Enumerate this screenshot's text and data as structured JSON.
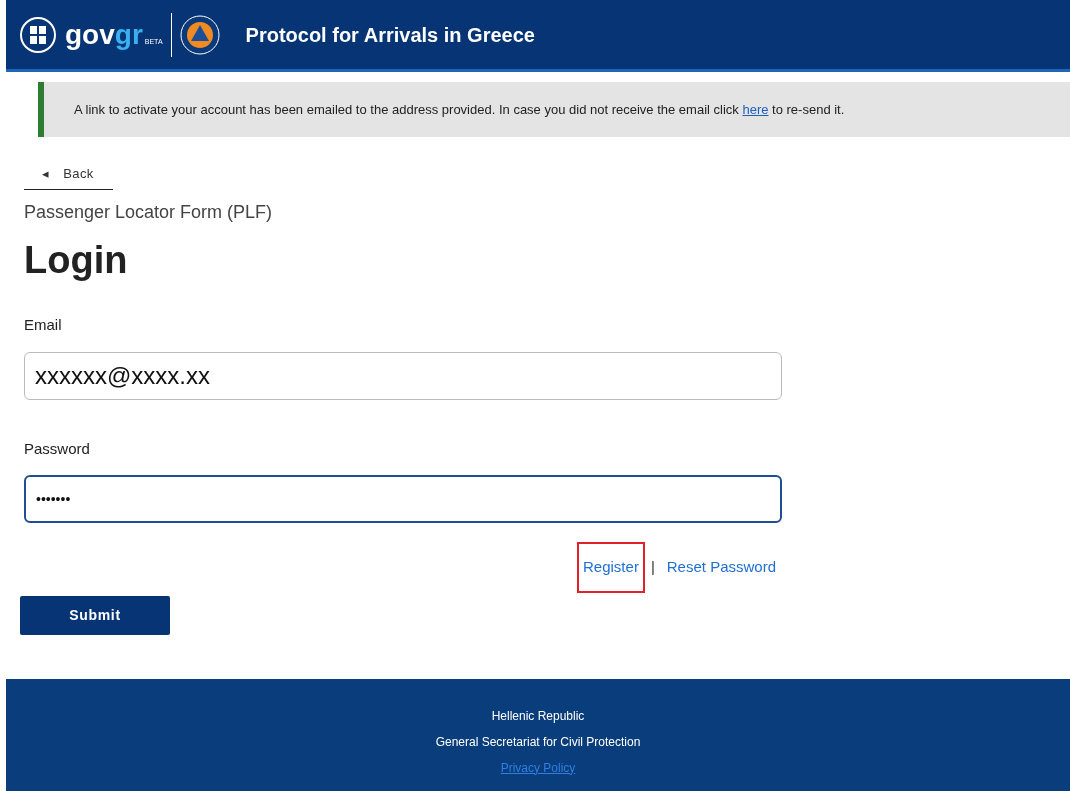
{
  "header": {
    "logo_gov": "gov",
    "logo_gr": "gr",
    "logo_beta": "BETA",
    "title": "Protocol for Arrivals in Greece"
  },
  "alert": {
    "text_before": "A link to activate your account has been emailed to the address provided. In case you did not receive the email click ",
    "link": "here",
    "text_after": " to re-send it."
  },
  "back": {
    "arrow": "◂",
    "label": "Back"
  },
  "subtitle": "Passenger Locator Form (PLF)",
  "heading": "Login",
  "fields": [
    {
      "label": "Email",
      "value": "xxxxxx@xxxx.xx",
      "kind": "email",
      "focused": false
    },
    {
      "label": "Password",
      "value": "•••••••",
      "kind": "password",
      "focused": true
    }
  ],
  "links": [
    {
      "label": "Register",
      "highlighted": true
    },
    {
      "label": "Reset Password",
      "highlighted": false
    }
  ],
  "separator": "|",
  "submit": "Submit",
  "footer": {
    "lines": [
      "Hellenic Republic",
      "General Secretariat for Civil Protection"
    ],
    "link": "Privacy Policy"
  }
}
